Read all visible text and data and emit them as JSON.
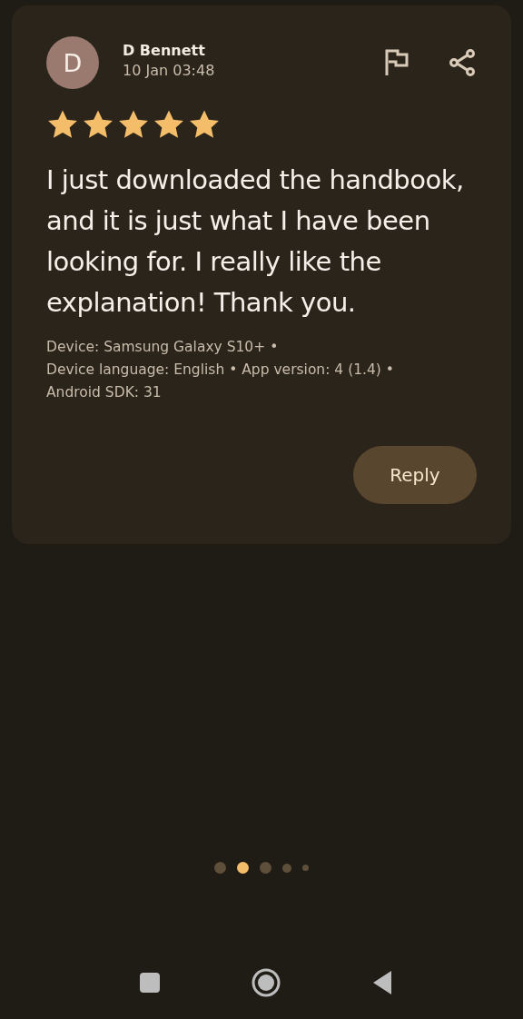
{
  "review": {
    "avatar_letter": "D",
    "author": "D Bennett",
    "date": "10 Jan 03:48",
    "stars": 5,
    "text": "I just downloaded the handbook, and it is just what I have been looking for. I really like the explanation! Thank you.",
    "device_info": [
      "Device: Samsung Galaxy S10+ •",
      "Device language: English • App version: 4 (1.4) •",
      "Android SDK: 31"
    ],
    "reply_button": "Reply"
  },
  "pager": [
    {
      "selected": false
    },
    {
      "selected": true
    },
    {
      "selected": false
    },
    {
      "selected": false
    },
    {
      "selected": false
    }
  ]
}
